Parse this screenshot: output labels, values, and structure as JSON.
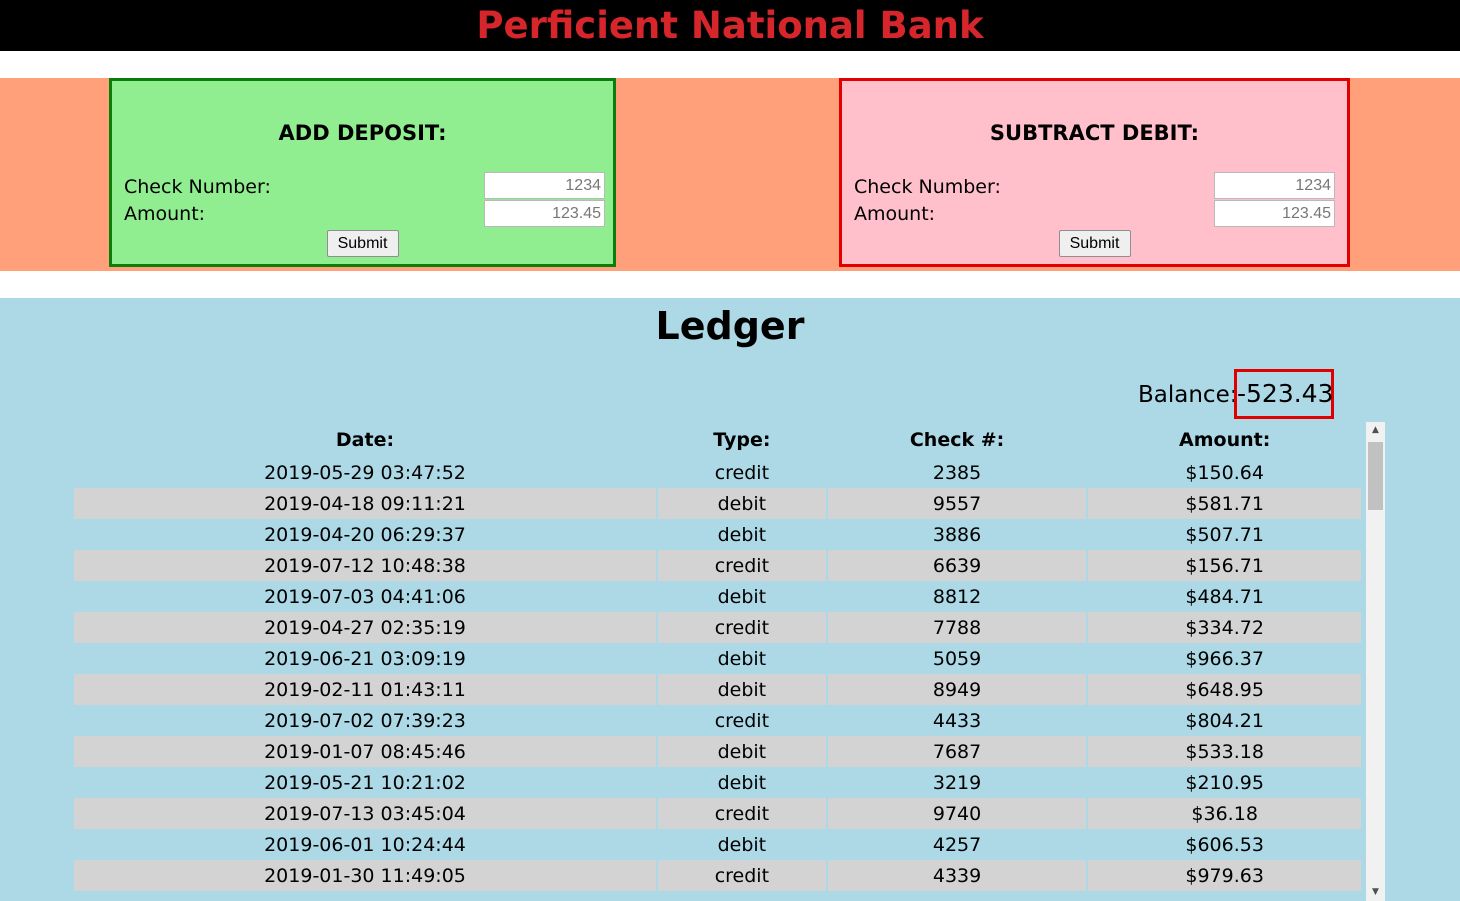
{
  "header": {
    "title": "Perficient National Bank"
  },
  "deposit": {
    "title": "ADD DEPOSIT:",
    "check_label": "Check Number:",
    "amount_label": "Amount:",
    "check_placeholder": "1234",
    "amount_placeholder": "123.45",
    "submit_label": "Submit"
  },
  "debit": {
    "title": "SUBTRACT DEBIT:",
    "check_label": "Check Number:",
    "amount_label": "Amount:",
    "check_placeholder": "1234",
    "amount_placeholder": "123.45",
    "submit_label": "Submit"
  },
  "ledger": {
    "title": "Ledger",
    "balance_label": "Balance:",
    "balance_value": "-523.43",
    "columns": [
      "Date:",
      "Type:",
      "Check #:",
      "Amount:"
    ],
    "rows": [
      [
        "2019-05-29 03:47:52",
        "credit",
        "2385",
        "$150.64"
      ],
      [
        "2019-04-18 09:11:21",
        "debit",
        "9557",
        "$581.71"
      ],
      [
        "2019-04-20 06:29:37",
        "debit",
        "3886",
        "$507.71"
      ],
      [
        "2019-07-12 10:48:38",
        "credit",
        "6639",
        "$156.71"
      ],
      [
        "2019-07-03 04:41:06",
        "debit",
        "8812",
        "$484.71"
      ],
      [
        "2019-04-27 02:35:19",
        "credit",
        "7788",
        "$334.72"
      ],
      [
        "2019-06-21 03:09:19",
        "debit",
        "5059",
        "$966.37"
      ],
      [
        "2019-02-11 01:43:11",
        "debit",
        "8949",
        "$648.95"
      ],
      [
        "2019-07-02 07:39:23",
        "credit",
        "4433",
        "$804.21"
      ],
      [
        "2019-01-07 08:45:46",
        "debit",
        "7687",
        "$533.18"
      ],
      [
        "2019-05-21 10:21:02",
        "debit",
        "3219",
        "$210.95"
      ],
      [
        "2019-07-13 03:45:04",
        "credit",
        "9740",
        "$36.18"
      ],
      [
        "2019-06-01 10:24:44",
        "debit",
        "4257",
        "$606.53"
      ],
      [
        "2019-01-30 11:49:05",
        "credit",
        "4339",
        "$979.63"
      ]
    ]
  },
  "colors": {
    "header_bg": "#000000",
    "title_red": "#d7262b",
    "forms_band": "#ffa07a",
    "deposit_bg": "#90ee90",
    "deposit_border": "#0a7d0a",
    "debit_bg": "#ffc0cb",
    "debit_border": "#e00000",
    "ledger_bg": "#add8e6",
    "alt_row": "#d3d3d3"
  },
  "icons": {
    "scroll_up": "triangle-up-icon",
    "scroll_down": "triangle-down-icon"
  }
}
